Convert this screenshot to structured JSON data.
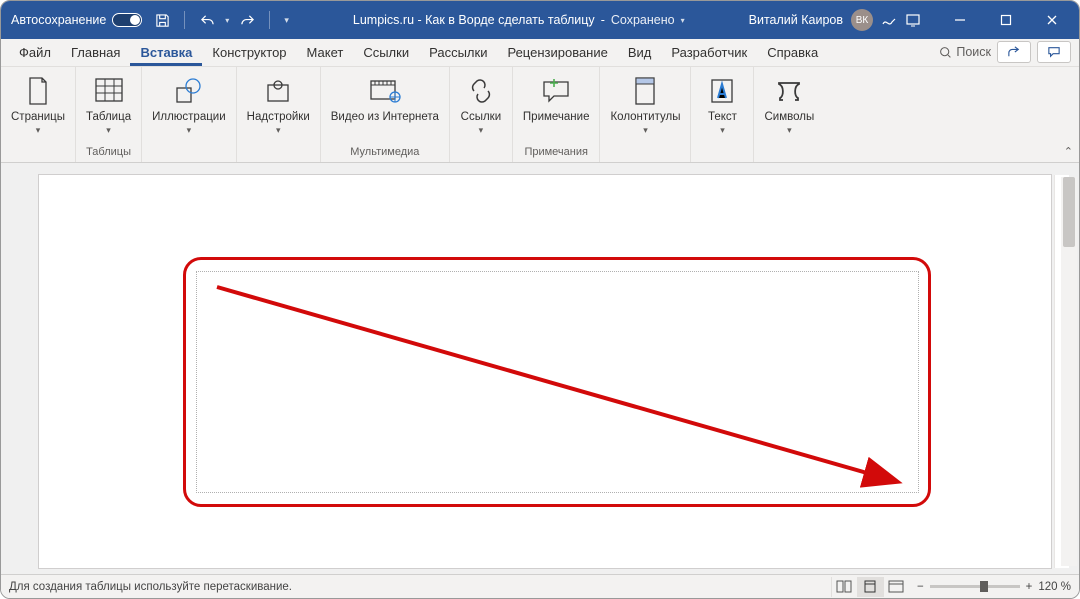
{
  "title": {
    "autosave": "Автосохранение",
    "doc": "Lumpics.ru - Как в Ворде сделать таблицу",
    "status": "Сохранено",
    "user": "Виталий Каиров",
    "avatar": "ВК"
  },
  "menu": {
    "items": [
      "Файл",
      "Главная",
      "Вставка",
      "Конструктор",
      "Макет",
      "Ссылки",
      "Рассылки",
      "Рецензирование",
      "Вид",
      "Разработчик",
      "Справка"
    ],
    "active": 2,
    "search": "Поиск"
  },
  "ribbon": {
    "pages": "Страницы",
    "table": "Таблица",
    "tables_group": "Таблицы",
    "illustrations": "Иллюстрации",
    "addins": "Надстройки",
    "video": "Видео из Интернета",
    "multimedia_group": "Мультимедиа",
    "links": "Ссылки",
    "comment": "Примечание",
    "comments_group": "Примечания",
    "headers": "Колонтитулы",
    "text": "Текст",
    "symbols": "Символы"
  },
  "status": {
    "msg": "Для создания таблицы используйте перетаскивание.",
    "zoom": "120 %"
  }
}
